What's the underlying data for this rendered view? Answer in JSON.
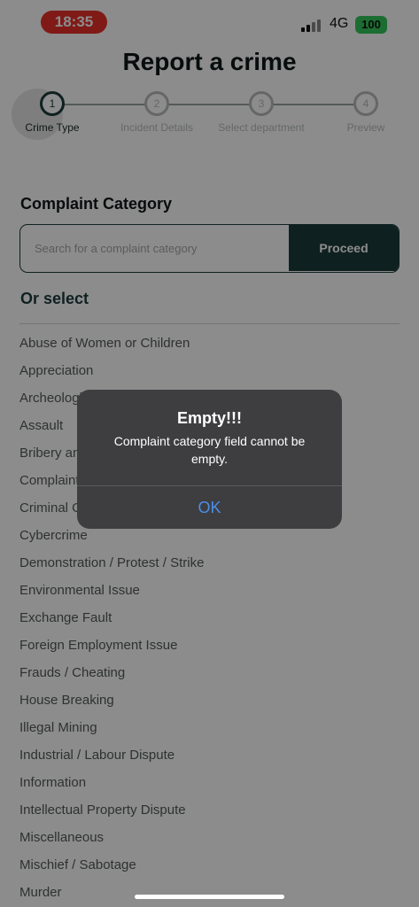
{
  "status_bar": {
    "time": "18:35",
    "network": "4G",
    "battery": "100",
    "colors": {
      "time_pill": "#e8302a",
      "battery": "#34c759"
    }
  },
  "header": {
    "title": "Report a crime"
  },
  "stepper": {
    "steps": [
      {
        "number": "1",
        "label": "Crime Type"
      },
      {
        "number": "2",
        "label": "Incident Details"
      },
      {
        "number": "3",
        "label": "Select department"
      },
      {
        "number": "4",
        "label": "Preview"
      }
    ],
    "active_step": 1
  },
  "complaint": {
    "section_title": "Complaint Category",
    "search": {
      "placeholder": "Search for a complaint category",
      "value": ""
    },
    "proceed_label": "Proceed",
    "or_select_label": "Or select",
    "categories": [
      "Abuse of Women or Children",
      "Appreciation",
      "Archeological",
      "Assault",
      "Bribery and Corruption",
      "Complaint",
      "Criminal Offence",
      "Cybercrime",
      "Demonstration / Protest / Strike",
      "Environmental Issue",
      "Exchange Fault",
      "Foreign Employment Issue",
      "Frauds / Cheating",
      "House Breaking",
      "Illegal Mining",
      "Industrial / Labour Dispute",
      "Information",
      "Intellectual Property Dispute",
      "Miscellaneous",
      "Mischief / Sabotage",
      "Murder"
    ]
  },
  "alert": {
    "title": "Empty!!!",
    "message": "Complaint category field cannot be empty.",
    "ok_label": "OK"
  },
  "theme": {
    "primary": "#1d3b3b",
    "alert_bg": "#3e3d40",
    "link_blue": "#4a8fe8"
  }
}
